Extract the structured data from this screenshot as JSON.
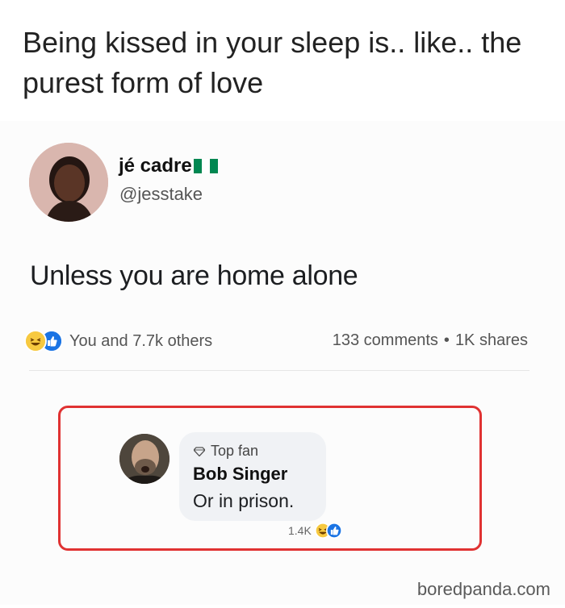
{
  "header": {
    "caption": "Being kissed in your sleep is.. like.. the purest form of love"
  },
  "post": {
    "author_name": "jé cadre",
    "author_flag": "nigeria-flag-icon",
    "author_handle": "@jesstake",
    "text": "Unless you are home alone",
    "reactions_label": "You and 7.7k others",
    "comments_label": "133 comments",
    "separator": "•",
    "shares_label": "1K shares",
    "reaction_icons": [
      "laughing-emoji-icon",
      "thumbs-up-icon"
    ]
  },
  "comment": {
    "badge": "Top fan",
    "badge_icon": "diamond-icon",
    "author": "Bob Singer",
    "text": "Or in prison.",
    "reaction_count": "1.4K",
    "reaction_icons": [
      "laughing-emoji-icon",
      "thumbs-up-icon"
    ]
  },
  "watermark": {
    "text": "boredpanda.com"
  },
  "colors": {
    "highlight_border": "#e03232",
    "like_blue": "#1b74e4",
    "laugh_yellow": "#f7c940",
    "flag_green": "#008751"
  }
}
